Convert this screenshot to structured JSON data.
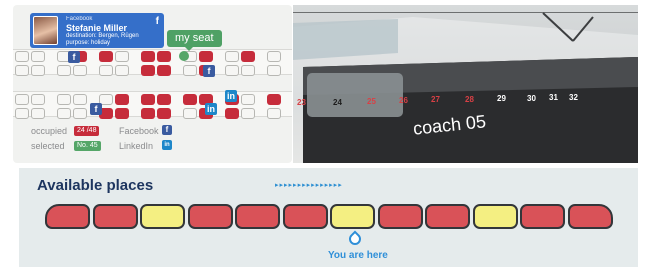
{
  "profile": {
    "network": "Facebook",
    "name": "Stefanie Miller",
    "destination": "destination: Bergen, Rügen",
    "purpose": "purpose: holiday",
    "network_icon": "f"
  },
  "seatmap": {
    "my_seat_label": "my seat",
    "occupied_color": "#c62c3b",
    "selected_color": "#55a668",
    "free_color": "#f6f6f4"
  },
  "legend": {
    "occupied_label": "occupied",
    "occupied_badge": "24 /48",
    "selected_label": "selected",
    "selected_badge": "No. 45",
    "facebook_label": "Facebook",
    "linkedin_label": "LinkedIn",
    "facebook_icon": "f",
    "linkedin_icon": "in"
  },
  "coach": {
    "label": "coach 05",
    "seat_numbers": [
      {
        "text": "23",
        "color": "#d84045"
      },
      {
        "text": "24",
        "color": "#1c1c1c"
      },
      {
        "text": "25",
        "color": "#d84045"
      },
      {
        "text": "26",
        "color": "#d84045"
      },
      {
        "text": "27",
        "color": "#d84045"
      },
      {
        "text": "28",
        "color": "#d84045"
      },
      {
        "text": "29",
        "color": "#ffffff"
      },
      {
        "text": "30",
        "color": "#ffffff"
      },
      {
        "text": "31",
        "color": "#ffffff"
      },
      {
        "text": "32",
        "color": "#ffffff"
      }
    ]
  },
  "available": {
    "title": "Available places",
    "you_are_here": "You are here",
    "wagon_status": [
      "red",
      "red",
      "yellow",
      "red",
      "red",
      "red",
      "yellow",
      "red",
      "red",
      "yellow",
      "red",
      "red"
    ],
    "status_colors": {
      "red": "#d95258",
      "yellow": "#f4ef82"
    }
  }
}
